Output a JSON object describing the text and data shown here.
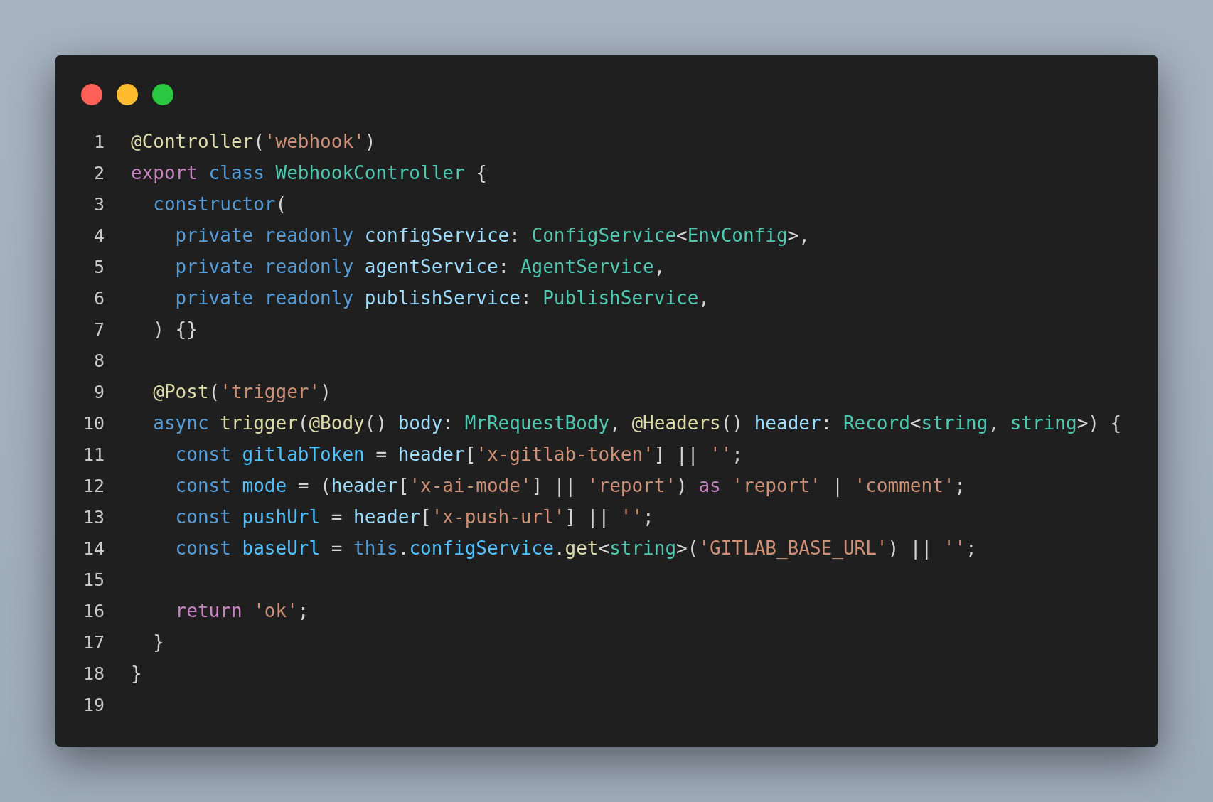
{
  "window": {
    "controls": [
      {
        "kind": "close"
      },
      {
        "kind": "minimize"
      },
      {
        "kind": "zoom"
      }
    ]
  },
  "code": [
    {
      "number": "1",
      "tokens": [
        {
          "t": "@Controller",
          "color": "#dcdcaa"
        },
        {
          "t": "(",
          "color": "#d4d4d4"
        },
        {
          "t": "'webhook'",
          "color": "#ce9178"
        },
        {
          "t": ")",
          "color": "#d4d4d4"
        }
      ]
    },
    {
      "number": "2",
      "tokens": [
        {
          "t": "export",
          "color": "#c586c0"
        },
        {
          "t": " class",
          "color": "#569cd6"
        },
        {
          "t": " WebhookController",
          "color": "#4ec9b0"
        },
        {
          "t": " {",
          "color": "#d4d4d4"
        }
      ]
    },
    {
      "number": "3",
      "tokens": [
        {
          "t": "  constructor",
          "color": "#569cd6"
        },
        {
          "t": "(",
          "color": "#d4d4d4"
        }
      ]
    },
    {
      "number": "4",
      "tokens": [
        {
          "t": "    private readonly",
          "color": "#569cd6"
        },
        {
          "t": " configService",
          "color": "#9cdcfe"
        },
        {
          "t": ": ",
          "color": "#d4d4d4"
        },
        {
          "t": "ConfigService",
          "color": "#4ec9b0"
        },
        {
          "t": "<",
          "color": "#d4d4d4"
        },
        {
          "t": "EnvConfig",
          "color": "#4ec9b0"
        },
        {
          "t": ">,",
          "color": "#d4d4d4"
        }
      ]
    },
    {
      "number": "5",
      "tokens": [
        {
          "t": "    private readonly",
          "color": "#569cd6"
        },
        {
          "t": " agentService",
          "color": "#9cdcfe"
        },
        {
          "t": ": ",
          "color": "#d4d4d4"
        },
        {
          "t": "AgentService",
          "color": "#4ec9b0"
        },
        {
          "t": ",",
          "color": "#d4d4d4"
        }
      ]
    },
    {
      "number": "6",
      "tokens": [
        {
          "t": "    private readonly",
          "color": "#569cd6"
        },
        {
          "t": " publishService",
          "color": "#9cdcfe"
        },
        {
          "t": ": ",
          "color": "#d4d4d4"
        },
        {
          "t": "PublishService",
          "color": "#4ec9b0"
        },
        {
          "t": ",",
          "color": "#d4d4d4"
        }
      ]
    },
    {
      "number": "7",
      "tokens": [
        {
          "t": "  ) {}",
          "color": "#d4d4d4"
        }
      ]
    },
    {
      "number": "8"
    },
    {
      "number": "9",
      "tokens": [
        {
          "t": "  @Post",
          "color": "#dcdcaa"
        },
        {
          "t": "(",
          "color": "#d4d4d4"
        },
        {
          "t": "'trigger'",
          "color": "#ce9178"
        },
        {
          "t": ")",
          "color": "#d4d4d4"
        }
      ]
    },
    {
      "number": "10",
      "tokens": [
        {
          "t": "  async",
          "color": "#569cd6"
        },
        {
          "t": " trigger",
          "color": "#dcdcaa"
        },
        {
          "t": "(",
          "color": "#d4d4d4"
        },
        {
          "t": "@Body",
          "color": "#dcdcaa"
        },
        {
          "t": "() ",
          "color": "#d4d4d4"
        },
        {
          "t": "body",
          "color": "#9cdcfe"
        },
        {
          "t": ": ",
          "color": "#d4d4d4"
        },
        {
          "t": "MrRequestBody",
          "color": "#4ec9b0"
        },
        {
          "t": ", ",
          "color": "#d4d4d4"
        },
        {
          "t": "@Headers",
          "color": "#dcdcaa"
        },
        {
          "t": "() ",
          "color": "#d4d4d4"
        },
        {
          "t": "header",
          "color": "#9cdcfe"
        },
        {
          "t": ": ",
          "color": "#d4d4d4"
        },
        {
          "t": "Record",
          "color": "#4ec9b0"
        },
        {
          "t": "<",
          "color": "#d4d4d4"
        },
        {
          "t": "string",
          "color": "#4ec9b0"
        },
        {
          "t": ", ",
          "color": "#d4d4d4"
        },
        {
          "t": "string",
          "color": "#4ec9b0"
        },
        {
          "t": ">) {",
          "color": "#d4d4d4"
        }
      ]
    },
    {
      "number": "11",
      "tokens": [
        {
          "t": "    const",
          "color": "#569cd6"
        },
        {
          "t": " gitlabToken",
          "color": "#4fc1ff"
        },
        {
          "t": " = ",
          "color": "#d4d4d4"
        },
        {
          "t": "header",
          "color": "#9cdcfe"
        },
        {
          "t": "[",
          "color": "#d4d4d4"
        },
        {
          "t": "'x-gitlab-token'",
          "color": "#ce9178"
        },
        {
          "t": "] || ",
          "color": "#d4d4d4"
        },
        {
          "t": "''",
          "color": "#ce9178"
        },
        {
          "t": ";",
          "color": "#d4d4d4"
        }
      ]
    },
    {
      "number": "12",
      "tokens": [
        {
          "t": "    const",
          "color": "#569cd6"
        },
        {
          "t": " mode",
          "color": "#4fc1ff"
        },
        {
          "t": " = (",
          "color": "#d4d4d4"
        },
        {
          "t": "header",
          "color": "#9cdcfe"
        },
        {
          "t": "[",
          "color": "#d4d4d4"
        },
        {
          "t": "'x-ai-mode'",
          "color": "#ce9178"
        },
        {
          "t": "] || ",
          "color": "#d4d4d4"
        },
        {
          "t": "'report'",
          "color": "#ce9178"
        },
        {
          "t": ") ",
          "color": "#d4d4d4"
        },
        {
          "t": "as",
          "color": "#c586c0"
        },
        {
          "t": " 'report'",
          "color": "#ce9178"
        },
        {
          "t": " | ",
          "color": "#d4d4d4"
        },
        {
          "t": "'comment'",
          "color": "#ce9178"
        },
        {
          "t": ";",
          "color": "#d4d4d4"
        }
      ]
    },
    {
      "number": "13",
      "tokens": [
        {
          "t": "    const",
          "color": "#569cd6"
        },
        {
          "t": " pushUrl",
          "color": "#4fc1ff"
        },
        {
          "t": " = ",
          "color": "#d4d4d4"
        },
        {
          "t": "header",
          "color": "#9cdcfe"
        },
        {
          "t": "[",
          "color": "#d4d4d4"
        },
        {
          "t": "'x-push-url'",
          "color": "#ce9178"
        },
        {
          "t": "] || ",
          "color": "#d4d4d4"
        },
        {
          "t": "''",
          "color": "#ce9178"
        },
        {
          "t": ";",
          "color": "#d4d4d4"
        }
      ]
    },
    {
      "number": "14",
      "tokens": [
        {
          "t": "    const",
          "color": "#569cd6"
        },
        {
          "t": " baseUrl",
          "color": "#4fc1ff"
        },
        {
          "t": " = ",
          "color": "#d4d4d4"
        },
        {
          "t": "this",
          "color": "#569cd6"
        },
        {
          "t": ".",
          "color": "#d4d4d4"
        },
        {
          "t": "configService",
          "color": "#4fc1ff"
        },
        {
          "t": ".",
          "color": "#d4d4d4"
        },
        {
          "t": "get",
          "color": "#dcdcaa"
        },
        {
          "t": "<",
          "color": "#d4d4d4"
        },
        {
          "t": "string",
          "color": "#4ec9b0"
        },
        {
          "t": ">(",
          "color": "#d4d4d4"
        },
        {
          "t": "'GITLAB_BASE_URL'",
          "color": "#ce9178"
        },
        {
          "t": ") || ",
          "color": "#d4d4d4"
        },
        {
          "t": "''",
          "color": "#ce9178"
        },
        {
          "t": ";",
          "color": "#d4d4d4"
        }
      ]
    },
    {
      "number": "15"
    },
    {
      "number": "16",
      "tokens": [
        {
          "t": "    return",
          "color": "#c586c0"
        },
        {
          "t": " 'ok'",
          "color": "#ce9178"
        },
        {
          "t": ";",
          "color": "#d4d4d4"
        }
      ]
    },
    {
      "number": "17",
      "tokens": [
        {
          "t": "  }",
          "color": "#d4d4d4"
        }
      ]
    },
    {
      "number": "18",
      "tokens": [
        {
          "t": "}",
          "color": "#d4d4d4"
        }
      ]
    },
    {
      "number": "19"
    }
  ]
}
